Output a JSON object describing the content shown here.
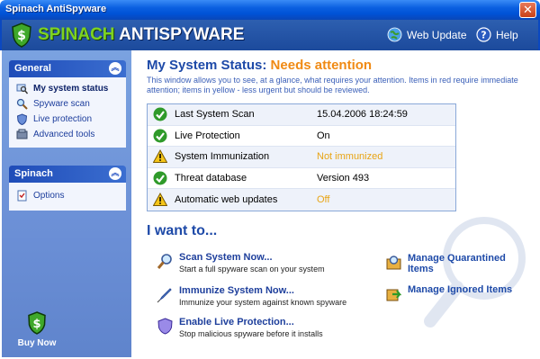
{
  "window": {
    "title": "Spinach AntiSpyware",
    "close_label": "✕"
  },
  "header": {
    "brand_part1": "SPINACH",
    "brand_part2": "ANTISPYWARE",
    "web_update_label": "Web Update",
    "help_label": "Help"
  },
  "sidebar": {
    "general": {
      "title": "General",
      "items": [
        {
          "label": "My system status",
          "icon": "monitor-magnifier-icon",
          "active": true
        },
        {
          "label": "Spyware scan",
          "icon": "magnifier-icon"
        },
        {
          "label": "Live protection",
          "icon": "shield-icon"
        },
        {
          "label": "Advanced tools",
          "icon": "tools-icon"
        }
      ]
    },
    "spinach": {
      "title": "Spinach",
      "items": [
        {
          "label": "Options",
          "icon": "checklist-icon"
        }
      ]
    },
    "buy_now_label": "Buy Now"
  },
  "main": {
    "title_prefix": "My System Status:",
    "title_status": "Needs attention",
    "description": "This window allows you to see, at a glance, what requires your attention.  Items in red require immediate attention; items in yellow - less urgent but should be reviewed.",
    "status_rows": [
      {
        "label": "Last System Scan",
        "value": "15.04.2006 18:24:59",
        "icon": "check-ok-icon",
        "level": "ok"
      },
      {
        "label": "Live Protection",
        "value": "On",
        "icon": "check-ok-icon",
        "level": "ok"
      },
      {
        "label": "System Immunization",
        "value": "Not immunized",
        "icon": "warning-icon",
        "level": "warning"
      },
      {
        "label": "Threat database",
        "value": "Version 493",
        "icon": "check-ok-icon",
        "level": "ok"
      },
      {
        "label": "Automatic web updates",
        "value": "Off",
        "icon": "warning-icon",
        "level": "warning"
      }
    ],
    "i_want_to": "I want to...",
    "actions": [
      {
        "title": "Scan System Now...",
        "desc": "Start a full spyware scan on your system",
        "icon": "magnifier-icon"
      },
      {
        "title": "Immunize System Now...",
        "desc": "Immunize your system against known spyware",
        "icon": "syringe-icon"
      },
      {
        "title": "Enable Live Protection...",
        "desc": "Stop malicious spyware before it installs",
        "icon": "shield-icon"
      }
    ],
    "right_actions": [
      {
        "title": "Manage Quarantined Items",
        "icon": "quarantine-box-icon"
      },
      {
        "title": "Manage Ignored Items",
        "icon": "ignore-arrow-icon"
      }
    ]
  },
  "colors": {
    "accent_blue": "#1e4aa8",
    "warning_orange": "#f08a14",
    "warning_yellow": "#e8a414",
    "ok_green": "#2f9a2a"
  }
}
